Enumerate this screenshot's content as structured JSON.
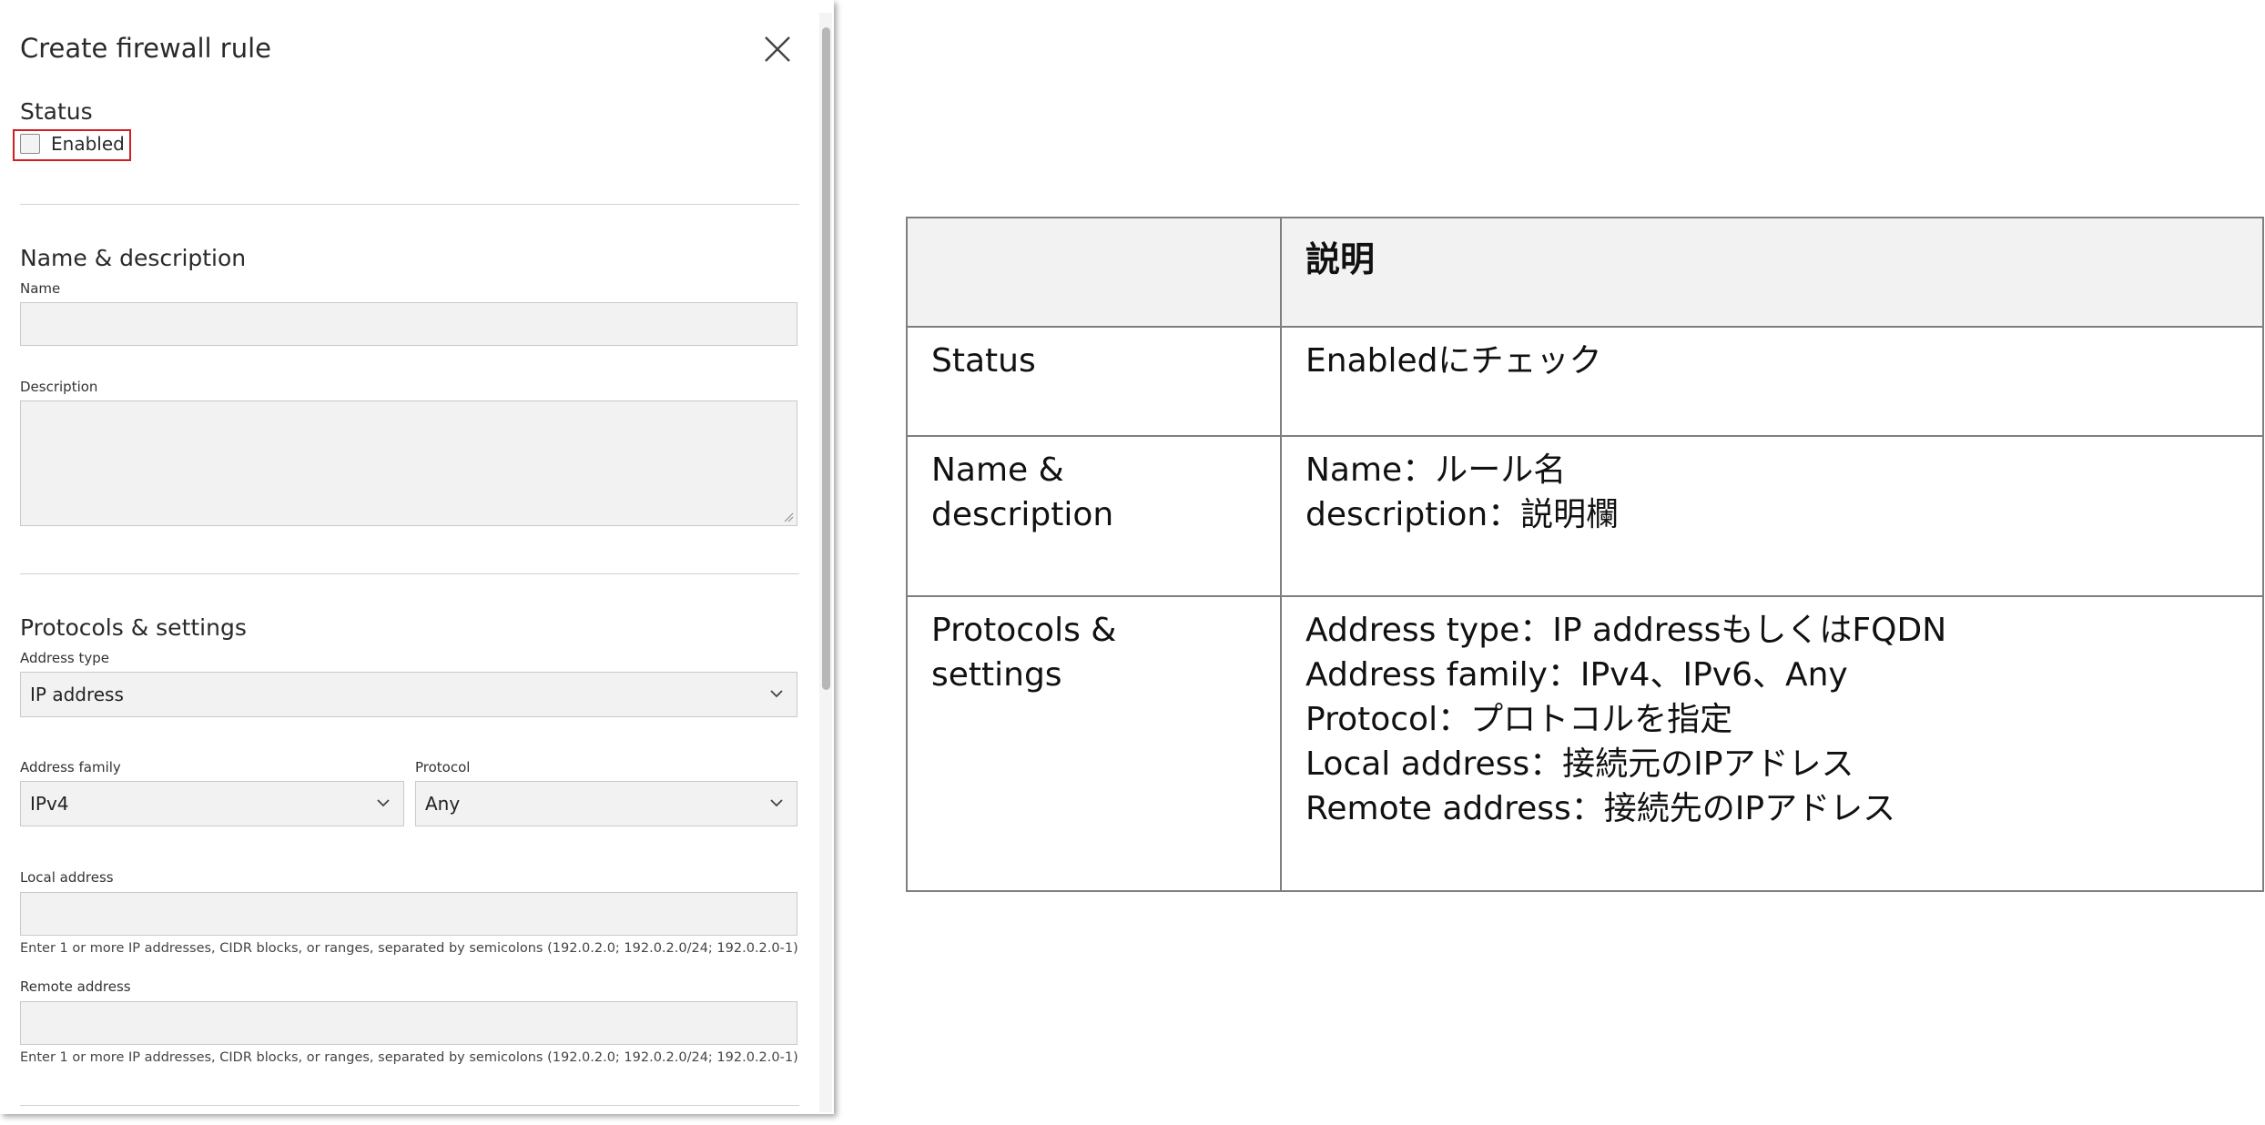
{
  "dialog": {
    "title": "Create firewall rule",
    "close_icon": "close-icon",
    "status": {
      "section_title": "Status",
      "enabled_label": "Enabled",
      "enabled_checked": false,
      "highlight_color": "#d01f1f"
    },
    "name_description": {
      "section_title": "Name & description",
      "name_label": "Name",
      "name_value": "",
      "description_label": "Description",
      "description_value": ""
    },
    "protocols": {
      "section_title": "Protocols & settings",
      "address_type_label": "Address type",
      "address_type_value": "IP address",
      "address_family_label": "Address family",
      "address_family_value": "IPv4",
      "protocol_label": "Protocol",
      "protocol_value": "Any",
      "local_address_label": "Local address",
      "local_address_value": "",
      "local_address_helper": "Enter 1 or more IP addresses, CIDR blocks, or ranges, separated by semicolons (192.0.2.0; 192.0.2.0/24; 192.0.2.0-1)",
      "remote_address_label": "Remote address",
      "remote_address_value": "",
      "remote_address_helper": "Enter 1 or more IP addresses, CIDR blocks, or ranges, separated by semicolons (192.0.2.0; 192.0.2.0/24; 192.0.2.0-1)"
    }
  },
  "table": {
    "header": [
      "",
      "説明"
    ],
    "rows": [
      {
        "label": "Status",
        "lines": [
          "Enabledにチェック"
        ]
      },
      {
        "label": "Name & description",
        "lines": [
          "Name：ルール名",
          "description：説明欄"
        ]
      },
      {
        "label": "Protocols & settings",
        "lines": [
          "Address type：IP addressもしくはFQDN",
          "Address family：IPv4、IPv6、Any",
          "Protocol：プロトコルを指定",
          "Local address：接続元のIPアドレス",
          "Remote address：接続先のIPアドレス"
        ]
      }
    ],
    "header_bg": "#f2f2f2",
    "border_color": "#7f7f7f"
  }
}
